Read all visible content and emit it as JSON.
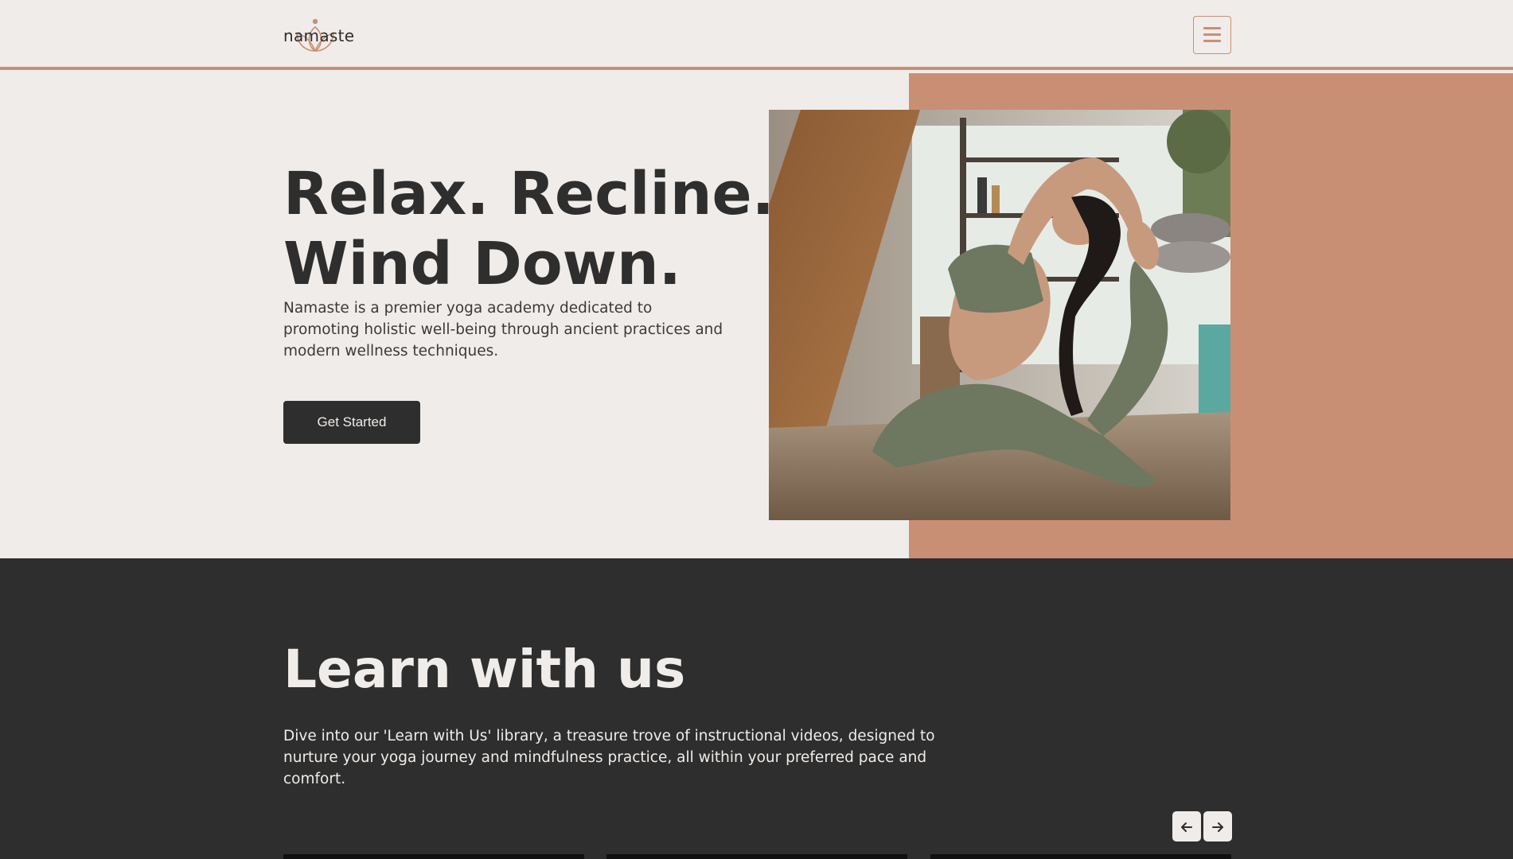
{
  "header": {
    "logo_text": "namaste",
    "logo_icon": "lotus-icon",
    "menu_icon": "hamburger-icon"
  },
  "hero": {
    "title_line1": "Relax. Recline.",
    "title_line2": "Wind Down.",
    "description": "Namaste is a premier yoga academy dedicated to promoting holistic well-being through ancient practices and modern wellness techniques.",
    "cta_label": "Get Started",
    "image_alt": "Woman practicing a yoga pose indoors"
  },
  "learn": {
    "title": "Learn with us",
    "description": "Dive into our 'Learn with Us' library, a treasure trove of instructional videos, designed to nurture your yoga journey and mindfulness practice, all within your preferred pace and comfort.",
    "prev_icon": "arrow-left-icon",
    "next_icon": "arrow-right-icon"
  },
  "colors": {
    "accent": "#c98f75",
    "background": "#f0ece9",
    "dark": "#2e2e2e"
  }
}
